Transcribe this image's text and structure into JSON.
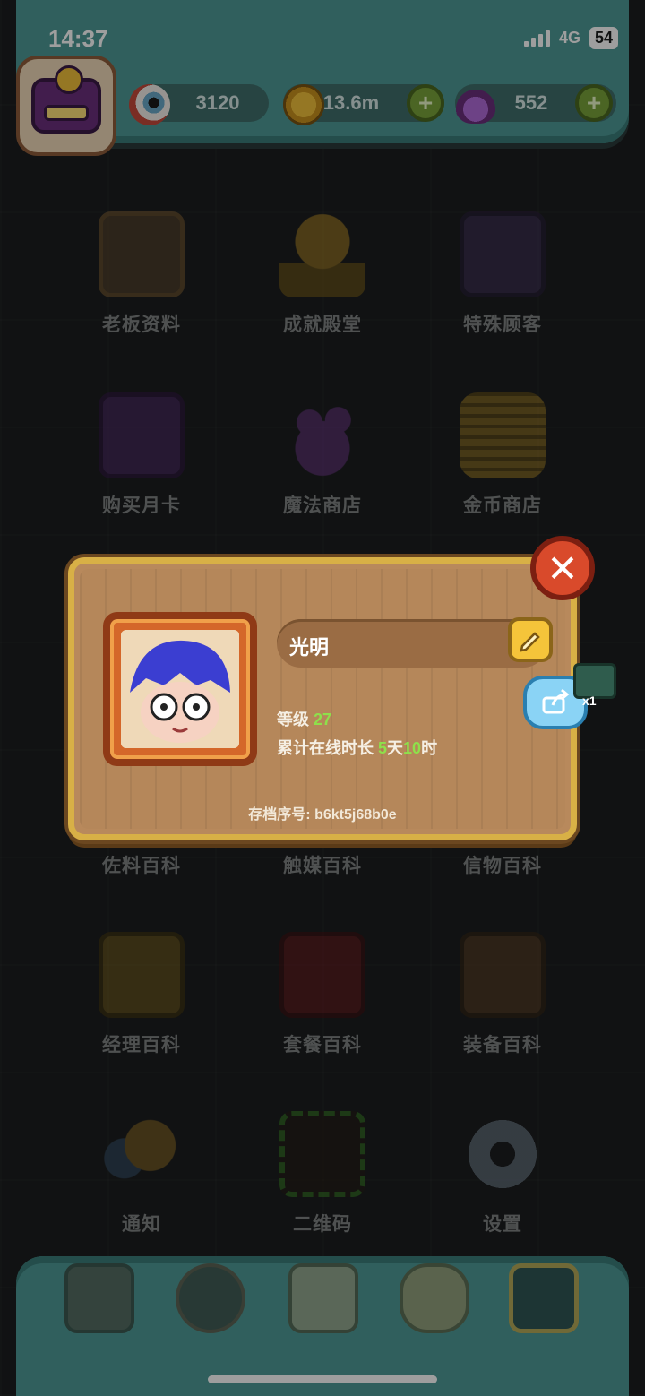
{
  "status_bar": {
    "time": "14:37",
    "network": "4G",
    "battery": "54"
  },
  "resources": {
    "eyeball": "3120",
    "coins": "13.6m",
    "potion": "552"
  },
  "menu": [
    {
      "label": "老板资料",
      "icon": "boss-profile-icon"
    },
    {
      "label": "成就殿堂",
      "icon": "trophy-icon"
    },
    {
      "label": "特殊顾客",
      "icon": "special-customer-icon"
    },
    {
      "label": "购买月卡",
      "icon": "monthly-card-icon"
    },
    {
      "label": "魔法商店",
      "icon": "magic-potion-icon"
    },
    {
      "label": "金币商店",
      "icon": "gold-coin-stack-icon"
    },
    {
      "label": "佐料百科",
      "icon": "seasoning-book-icon"
    },
    {
      "label": "触媒百科",
      "icon": "catalyst-book-icon"
    },
    {
      "label": "信物百科",
      "icon": "token-book-icon"
    },
    {
      "label": "经理百科",
      "icon": "manager-book-icon"
    },
    {
      "label": "套餐百科",
      "icon": "combo-book-icon"
    },
    {
      "label": "装备百科",
      "icon": "equipment-book-icon"
    },
    {
      "label": "通知",
      "icon": "megaphone-icon"
    },
    {
      "label": "二维码",
      "icon": "qr-code-icon"
    },
    {
      "label": "设置",
      "icon": "gear-icon"
    }
  ],
  "dock": [
    {
      "icon": "restaurant-icon"
    },
    {
      "icon": "monster-icon"
    },
    {
      "icon": "book-icon"
    },
    {
      "icon": "money-bag-icon"
    },
    {
      "icon": "grid-menu-icon"
    }
  ],
  "profile_dialog": {
    "name": "光明",
    "level_label": "等级",
    "level_value": "27",
    "online_label": "累计在线时长",
    "online_days": "5",
    "online_days_unit": "天",
    "online_hours": "10",
    "online_hours_unit": "时",
    "save_id_label": "存档序号: b6kt5j68b0e",
    "ticket_count": "x1"
  },
  "colors": {
    "teal_bar": "#4e9a96",
    "dialog_wood": "#b8895c",
    "dialog_border": "#d8b046",
    "level_green": "#8ee04b",
    "close_red": "#d94a2b"
  }
}
